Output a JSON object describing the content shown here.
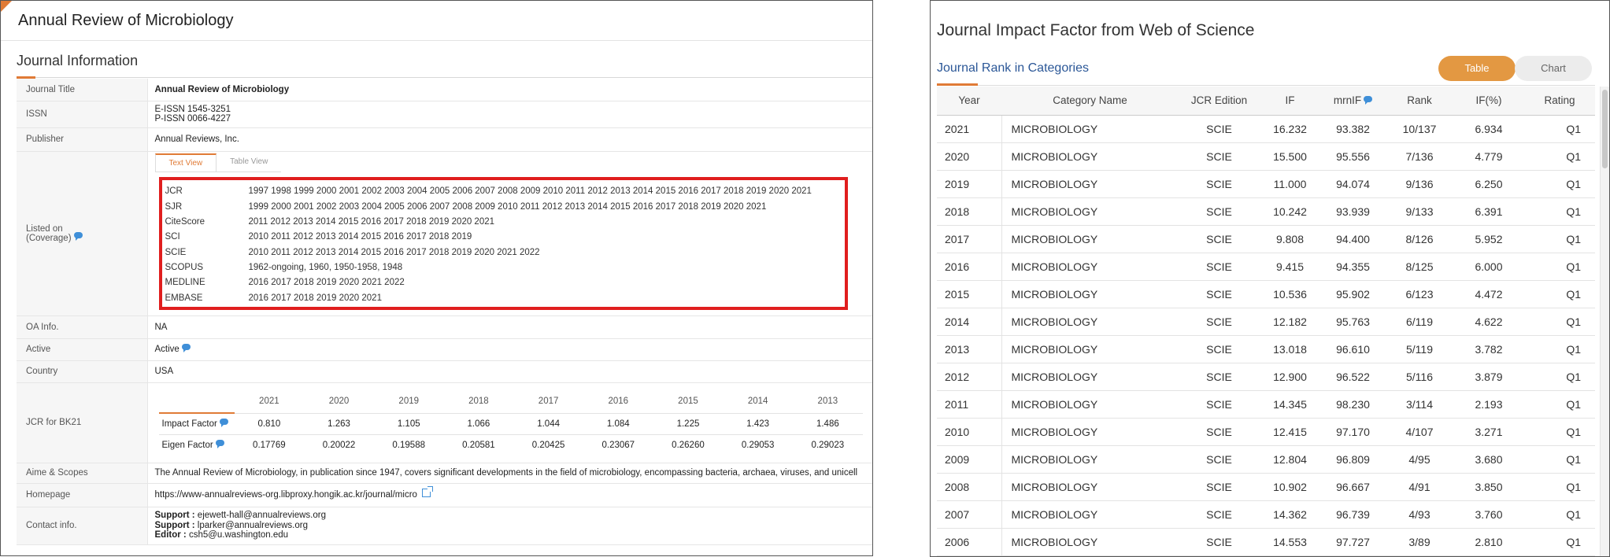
{
  "left": {
    "journal_title_header": "Annual Review of Microbiology",
    "section_title": "Journal Information",
    "rows": {
      "journal_title": {
        "label": "Journal Title",
        "value": "Annual Review of Microbiology"
      },
      "issn": {
        "label": "ISSN",
        "e_issn": "E-ISSN 1545-3251",
        "p_issn": "P-ISSN 0066-4227"
      },
      "publisher": {
        "label": "Publisher",
        "value": "Annual Reviews, Inc."
      },
      "listed_on": {
        "label_line1": "Listed on",
        "label_line2": "(Coverage)"
      },
      "oa_info": {
        "label": "OA Info.",
        "value": "NA"
      },
      "active": {
        "label": "Active",
        "value": "Active"
      },
      "country": {
        "label": "Country",
        "value": "USA"
      },
      "jcr_bk21": {
        "label": "JCR for BK21"
      },
      "aims": {
        "label": "Aime & Scopes",
        "value": "The Annual Review of Microbiology, in publication since 1947, covers significant developments in the field of microbiology, encompassing bacteria, archaea, viruses, and unicell"
      },
      "homepage": {
        "label": "Homepage",
        "value": "https://www-annualreviews-org.libproxy.hongik.ac.kr/journal/micro"
      },
      "contact": {
        "label": "Contact info.",
        "lines": [
          {
            "role": "Support :",
            "email": " ejewett-hall@annualreviews.org"
          },
          {
            "role": "Support :",
            "email": " lparker@annualreviews.org"
          },
          {
            "role": "Editor :",
            "email": " csh5@u.washington.edu"
          }
        ]
      }
    },
    "coverage_tabs": [
      "Text View",
      "Table View"
    ],
    "coverage": [
      {
        "name": "JCR",
        "years": "1997 1998 1999 2000 2001 2002 2003 2004 2005 2006 2007 2008 2009 2010 2011 2012 2013 2014 2015 2016 2017 2018 2019 2020 2021"
      },
      {
        "name": "SJR",
        "years": "1999 2000 2001 2002 2003 2004 2005 2006 2007 2008 2009 2010 2011 2012 2013 2014 2015 2016 2017 2018 2019 2020 2021"
      },
      {
        "name": "CiteScore",
        "years": "2011 2012 2013 2014 2015 2016 2017 2018 2019 2020 2021"
      },
      {
        "name": "SCI",
        "years": "2010 2011 2012 2013 2014 2015 2016 2017 2018 2019"
      },
      {
        "name": "SCIE",
        "years": "2010 2011 2012 2013 2014 2015 2016 2017 2018 2019 2020 2021 2022"
      },
      {
        "name": "SCOPUS",
        "years": "1962-ongoing, 1960, 1950-1958, 1948"
      },
      {
        "name": "MEDLINE",
        "years": "2016 2017 2018 2019 2020 2021 2022"
      },
      {
        "name": "EMBASE",
        "years": "2016 2017 2018 2019 2020 2021"
      }
    ],
    "bk21": {
      "years": [
        "2021",
        "2020",
        "2019",
        "2018",
        "2017",
        "2016",
        "2015",
        "2014",
        "2013"
      ],
      "impact_factor_label": "Impact Factor",
      "impact_factor": [
        "0.810",
        "1.263",
        "1.105",
        "1.066",
        "1.044",
        "1.084",
        "1.225",
        "1.423",
        "1.486"
      ],
      "eigen_factor_label": "Eigen Factor",
      "eigen_factor": [
        "0.17769",
        "0.20022",
        "0.19588",
        "0.20581",
        "0.20425",
        "0.23067",
        "0.26260",
        "0.29053",
        "0.29023"
      ]
    }
  },
  "right": {
    "title": "Journal Impact Factor from Web of Science",
    "subtitle": "Journal Rank in Categories",
    "toggle": {
      "table": "Table",
      "chart": "Chart"
    },
    "columns": [
      "Year",
      "Category Name",
      "JCR Edition",
      "IF",
      "mrnIF",
      "Rank",
      "IF(%)",
      "Rating"
    ],
    "rows": [
      {
        "year": "2021",
        "category": "MICROBIOLOGY",
        "edition": "SCIE",
        "if": "16.232",
        "mrnif": "93.382",
        "rank": "10/137",
        "ifpct": "6.934",
        "rating": "Q1"
      },
      {
        "year": "2020",
        "category": "MICROBIOLOGY",
        "edition": "SCIE",
        "if": "15.500",
        "mrnif": "95.556",
        "rank": "7/136",
        "ifpct": "4.779",
        "rating": "Q1"
      },
      {
        "year": "2019",
        "category": "MICROBIOLOGY",
        "edition": "SCIE",
        "if": "11.000",
        "mrnif": "94.074",
        "rank": "9/136",
        "ifpct": "6.250",
        "rating": "Q1"
      },
      {
        "year": "2018",
        "category": "MICROBIOLOGY",
        "edition": "SCIE",
        "if": "10.242",
        "mrnif": "93.939",
        "rank": "9/133",
        "ifpct": "6.391",
        "rating": "Q1"
      },
      {
        "year": "2017",
        "category": "MICROBIOLOGY",
        "edition": "SCIE",
        "if": "9.808",
        "mrnif": "94.400",
        "rank": "8/126",
        "ifpct": "5.952",
        "rating": "Q1"
      },
      {
        "year": "2016",
        "category": "MICROBIOLOGY",
        "edition": "SCIE",
        "if": "9.415",
        "mrnif": "94.355",
        "rank": "8/125",
        "ifpct": "6.000",
        "rating": "Q1"
      },
      {
        "year": "2015",
        "category": "MICROBIOLOGY",
        "edition": "SCIE",
        "if": "10.536",
        "mrnif": "95.902",
        "rank": "6/123",
        "ifpct": "4.472",
        "rating": "Q1"
      },
      {
        "year": "2014",
        "category": "MICROBIOLOGY",
        "edition": "SCIE",
        "if": "12.182",
        "mrnif": "95.763",
        "rank": "6/119",
        "ifpct": "4.622",
        "rating": "Q1"
      },
      {
        "year": "2013",
        "category": "MICROBIOLOGY",
        "edition": "SCIE",
        "if": "13.018",
        "mrnif": "96.610",
        "rank": "5/119",
        "ifpct": "3.782",
        "rating": "Q1"
      },
      {
        "year": "2012",
        "category": "MICROBIOLOGY",
        "edition": "SCIE",
        "if": "12.900",
        "mrnif": "96.522",
        "rank": "5/116",
        "ifpct": "3.879",
        "rating": "Q1"
      },
      {
        "year": "2011",
        "category": "MICROBIOLOGY",
        "edition": "SCIE",
        "if": "14.345",
        "mrnif": "98.230",
        "rank": "3/114",
        "ifpct": "2.193",
        "rating": "Q1"
      },
      {
        "year": "2010",
        "category": "MICROBIOLOGY",
        "edition": "SCIE",
        "if": "12.415",
        "mrnif": "97.170",
        "rank": "4/107",
        "ifpct": "3.271",
        "rating": "Q1"
      },
      {
        "year": "2009",
        "category": "MICROBIOLOGY",
        "edition": "SCIE",
        "if": "12.804",
        "mrnif": "96.809",
        "rank": "4/95",
        "ifpct": "3.680",
        "rating": "Q1"
      },
      {
        "year": "2008",
        "category": "MICROBIOLOGY",
        "edition": "SCIE",
        "if": "10.902",
        "mrnif": "96.667",
        "rank": "4/91",
        "ifpct": "3.850",
        "rating": "Q1"
      },
      {
        "year": "2007",
        "category": "MICROBIOLOGY",
        "edition": "SCIE",
        "if": "14.362",
        "mrnif": "96.739",
        "rank": "4/93",
        "ifpct": "3.760",
        "rating": "Q1"
      },
      {
        "year": "2006",
        "category": "MICROBIOLOGY",
        "edition": "SCIE",
        "if": "14.553",
        "mrnif": "97.727",
        "rank": "3/89",
        "ifpct": "2.810",
        "rating": "Q1"
      }
    ]
  },
  "colors": {
    "accent_orange": "#e07b36",
    "highlight_red": "#e01e1e",
    "link_blue": "#2b5797",
    "icon_blue": "#3f8fd8",
    "toggle_active": "#e39842"
  }
}
